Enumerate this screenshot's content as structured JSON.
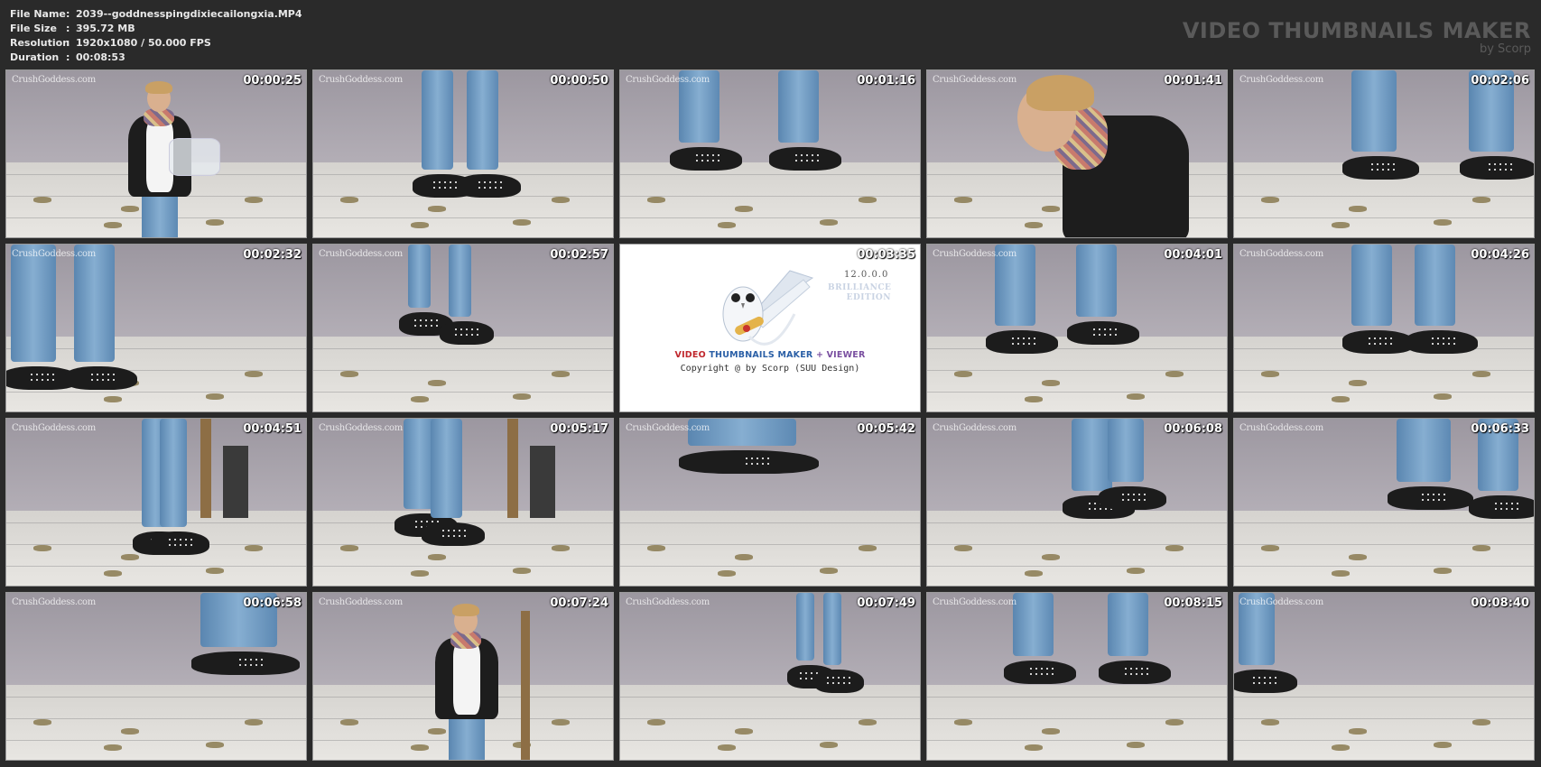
{
  "file_info": {
    "rows": [
      {
        "label": "File Name",
        "separator": ":",
        "value": "2039--goddnesspingdixiecailongxia.MP4"
      },
      {
        "label": "File Size",
        "separator": ":",
        "value": "395.72 MB"
      },
      {
        "label": "Resolution",
        "separator": ":",
        "value": "1920x1080 / 50.000 FPS"
      },
      {
        "label": "Duration",
        "separator": ":",
        "value": "00:08:53"
      }
    ]
  },
  "branding": {
    "title": "VIDEO THUMBNAILS MAKER",
    "subtitle": "by Scorp"
  },
  "watermark_text": "CrushGoddess.com",
  "logo_card": {
    "timecode": "00:03:35",
    "version": "12.0.0.0",
    "edition_line1": "BRILLIANCE",
    "edition_line2": "EDITION",
    "product_part1": "VIDEO",
    "product_part2": "THUMBNAILS MAKER",
    "product_part3": "+ VIEWER",
    "copyright": "Copyright @ by Scorp (SUU Design)",
    "icon": "owl-with-scroll-icon"
  },
  "thumbnails": [
    {
      "timecode": "00:00:25",
      "scene": "woman-holding-container"
    },
    {
      "timecode": "00:00:50",
      "scene": "feet-walking"
    },
    {
      "timecode": "00:01:16",
      "scene": "shoes-closeup"
    },
    {
      "timecode": "00:01:41",
      "scene": "woman-looking-down"
    },
    {
      "timecode": "00:02:06",
      "scene": "studded-shoes"
    },
    {
      "timecode": "00:02:32",
      "scene": "legs-standing"
    },
    {
      "timecode": "00:02:57",
      "scene": "walking-wide"
    },
    {
      "timecode": "00:03:35",
      "scene": "logo"
    },
    {
      "timecode": "00:04:01",
      "scene": "shoes-floor"
    },
    {
      "timecode": "00:04:26",
      "scene": "shoes-standing"
    },
    {
      "timecode": "00:04:51",
      "scene": "legs-room"
    },
    {
      "timecode": "00:05:17",
      "scene": "shoes-room"
    },
    {
      "timecode": "00:05:42",
      "scene": "shoe-closeup-low"
    },
    {
      "timecode": "00:06:08",
      "scene": "shoes-standing-wide"
    },
    {
      "timecode": "00:06:33",
      "scene": "studded-shoe-crush"
    },
    {
      "timecode": "00:06:58",
      "scene": "shoe-soles"
    },
    {
      "timecode": "00:07:24",
      "scene": "woman-standing"
    },
    {
      "timecode": "00:07:49",
      "scene": "walking-far"
    },
    {
      "timecode": "00:08:15",
      "scene": "shoes-pair"
    },
    {
      "timecode": "00:08:40",
      "scene": "foot-corner"
    }
  ]
}
